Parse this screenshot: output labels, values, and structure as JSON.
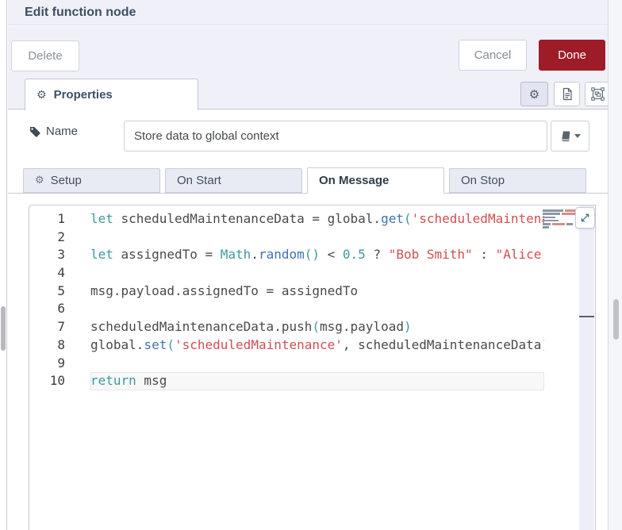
{
  "window": {
    "title": "Edit function node"
  },
  "buttons": {
    "delete": "Delete",
    "cancel": "Cancel",
    "done": "Done"
  },
  "properties_tab": {
    "label": "Properties"
  },
  "name_row": {
    "label": "Name",
    "value": "Store data to global context"
  },
  "icons": {
    "gear": "⚙"
  },
  "function_tabs": [
    {
      "label": "Setup",
      "icon": "gear",
      "active": false
    },
    {
      "label": "On Start",
      "active": false
    },
    {
      "label": "On Message",
      "active": true
    },
    {
      "label": "On Stop",
      "active": false
    }
  ],
  "editor": {
    "language": "javascript",
    "current_line": 10,
    "token_colors": {
      "keyword": "#3e999f",
      "function": "#4271ae",
      "string": "#d04f51",
      "number": "#3e999f",
      "paren": "#3e999f",
      "plain": "#4a4a4c"
    },
    "lines": [
      {
        "n": 1,
        "tokens": [
          [
            "keyword",
            "let"
          ],
          [
            "plain",
            " scheduledMaintenanceData = global."
          ],
          [
            "function",
            "get"
          ],
          [
            "paren",
            "("
          ],
          [
            "string",
            "'scheduledMaintenance'"
          ],
          [
            "paren",
            ")"
          ]
        ]
      },
      {
        "n": 2,
        "tokens": []
      },
      {
        "n": 3,
        "tokens": [
          [
            "keyword",
            "let"
          ],
          [
            "plain",
            " assignedTo = "
          ],
          [
            "keyword",
            "Math"
          ],
          [
            "plain",
            "."
          ],
          [
            "function",
            "random"
          ],
          [
            "paren",
            "()"
          ],
          [
            "plain",
            " < "
          ],
          [
            "number",
            "0.5"
          ],
          [
            "plain",
            " ? "
          ],
          [
            "string",
            "\"Bob Smith\""
          ],
          [
            "plain",
            " : "
          ],
          [
            "string",
            "\"Alice Johnson\""
          ]
        ]
      },
      {
        "n": 4,
        "tokens": []
      },
      {
        "n": 5,
        "tokens": [
          [
            "plain",
            "msg.payload.assignedTo = assignedTo"
          ]
        ]
      },
      {
        "n": 6,
        "tokens": []
      },
      {
        "n": 7,
        "tokens": [
          [
            "plain",
            "scheduledMaintenanceData.push"
          ],
          [
            "paren",
            "("
          ],
          [
            "plain",
            "msg.payload"
          ],
          [
            "paren",
            ")"
          ]
        ]
      },
      {
        "n": 8,
        "tokens": [
          [
            "plain",
            "global."
          ],
          [
            "function",
            "set"
          ],
          [
            "paren",
            "("
          ],
          [
            "string",
            "'scheduledMaintenance'"
          ],
          [
            "plain",
            ", scheduledMaintenanceData"
          ],
          [
            "paren",
            ")"
          ]
        ]
      },
      {
        "n": 9,
        "tokens": []
      },
      {
        "n": 10,
        "tokens": [
          [
            "keyword",
            "return"
          ],
          [
            "plain",
            " msg"
          ]
        ]
      }
    ]
  },
  "colors": {
    "done_button": "#9e1b28",
    "header_bg": "#f0f1f8",
    "inactive_tab_bg": "#e9ebf4",
    "editor_scroll_track": "#edeff8"
  }
}
